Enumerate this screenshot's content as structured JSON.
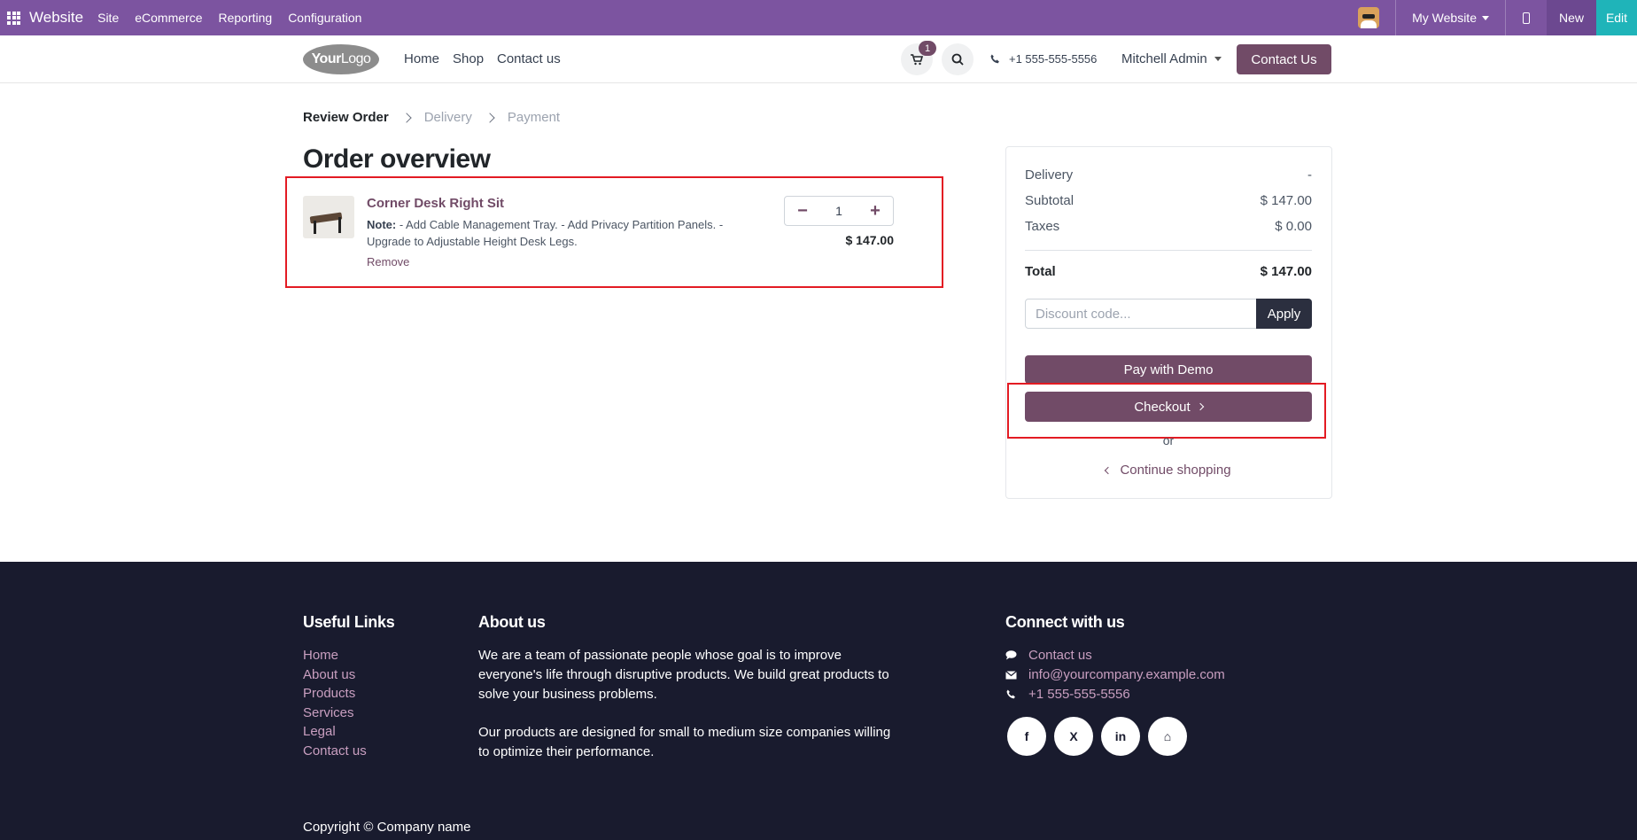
{
  "adminbar": {
    "brand": "Website",
    "menu": [
      "Site",
      "eCommerce",
      "Reporting",
      "Configuration"
    ],
    "website_selector": "My Website",
    "new_label": "New",
    "edit_label": "Edit"
  },
  "header": {
    "logo_bold": "Your",
    "logo_light": "Logo",
    "nav": [
      "Home",
      "Shop",
      "Contact us"
    ],
    "cart_count": "1",
    "phone": "+1 555-555-5556",
    "user": "Mitchell Admin",
    "contact_button": "Contact Us"
  },
  "steps": {
    "review": "Review Order",
    "delivery": "Delivery",
    "payment": "Payment"
  },
  "page_title": "Order overview",
  "order_line": {
    "product_name": "Corner Desk Right Sit",
    "note_label": "Note:",
    "note_text": " - Add Cable Management Tray. - Add Privacy Partition Panels. - Upgrade to Adjustable Height Desk Legs.",
    "remove_label": "Remove",
    "quantity": "1",
    "price": "$ 147.00"
  },
  "summary": {
    "delivery_label": "Delivery",
    "delivery_value": "-",
    "subtotal_label": "Subtotal",
    "subtotal_value": "$ 147.00",
    "taxes_label": "Taxes",
    "taxes_value": "$ 0.00",
    "total_label": "Total",
    "total_value": "$ 147.00",
    "discount_placeholder": "Discount code...",
    "apply_label": "Apply",
    "pay_demo_label": "Pay with Demo",
    "checkout_label": "Checkout",
    "or_label": "or",
    "continue_label": "Continue shopping"
  },
  "footer": {
    "useful_links_title": "Useful Links",
    "useful_links": [
      "Home",
      "About us",
      "Products",
      "Services",
      "Legal",
      "Contact us"
    ],
    "about_title": "About us",
    "about_p1": "We are a team of passionate people whose goal is to improve everyone's life through disruptive products. We build great products to solve your business problems.",
    "about_p2": "Our products are designed for small to medium size companies willing to optimize their performance.",
    "connect_title": "Connect with us",
    "connect_contact": "Contact us",
    "connect_email": "info@yourcompany.example.com",
    "connect_phone": "+1 555-555-5556",
    "social": [
      "f",
      "X",
      "in",
      "⌂"
    ],
    "copyright": "Copyright © Company name"
  },
  "colors": {
    "admin_bar": "#7c54a0",
    "brand_primary": "#714b67",
    "footer_bg": "#191b2e",
    "highlight": "#e31b23"
  }
}
